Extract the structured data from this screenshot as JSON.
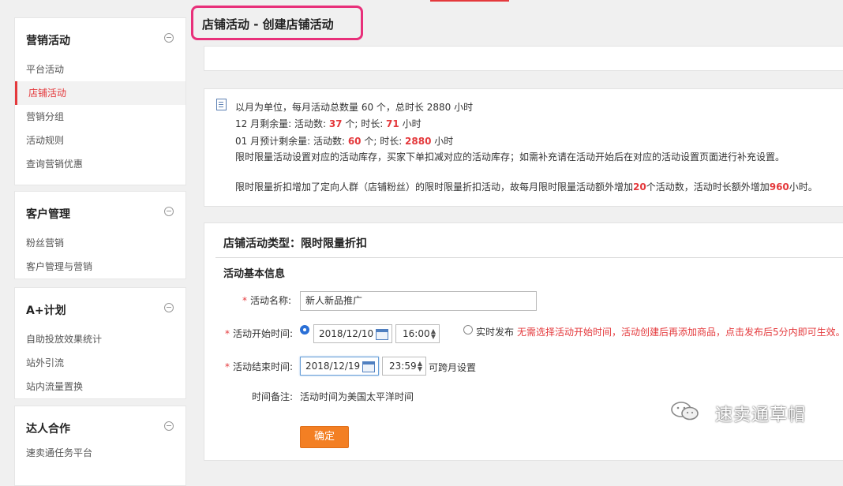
{
  "page": {
    "title": "店铺活动 - 创建店铺活动"
  },
  "sidebar": {
    "groups": [
      {
        "title": "营销活动",
        "items": [
          "平台活动",
          "店铺活动",
          "营销分组",
          "活动规则",
          "查询营销优惠"
        ],
        "active_index": 1
      },
      {
        "title": "客户管理",
        "items": [
          "粉丝营销",
          "客户管理与营销"
        ]
      },
      {
        "title": "A+计划",
        "items": [
          "自助投放效果统计",
          "站外引流",
          "站内流量置换"
        ]
      },
      {
        "title": "达人合作",
        "items": [
          "速卖通任务平台"
        ]
      }
    ]
  },
  "notice": {
    "line1": "以月为单位，每月活动总数量 60 个，总时长 2880 小时",
    "line2": {
      "prefix": "12 月剩余量: 活动数: ",
      "count": "37",
      "mid": " 个; 时长: ",
      "hours": "71",
      "suffix": " 小时"
    },
    "line3": {
      "prefix": "01 月预计剩余量: 活动数: ",
      "count": "60",
      "mid": " 个; 时长: ",
      "hours": "2880",
      "suffix": " 小时"
    },
    "line4": "限时限量活动设置对应的活动库存，买家下单扣减对应的活动库存；如需补充请在活动开始后在对应的活动设置页面进行补充设置。",
    "line5": {
      "prefix": "限时限量折扣增加了定向人群（店铺粉丝）的限时限量折扣活动，故每月限时限量活动额外增加",
      "count": "20",
      "mid": "个活动数，活动时长额外增加",
      "hours": "960",
      "suffix": "小时。"
    }
  },
  "form": {
    "type_title": "店铺活动类型：限时限量折扣",
    "section_title": "活动基本信息",
    "name_label": "活动名称:",
    "name_value": "新人新品推广",
    "start_label": "活动开始时间:",
    "start_date": "2018/12/10",
    "start_time": "16:00",
    "realtime_label": "实时发布",
    "realtime_hint": "无需选择活动开始时间，活动创建后再添加商品，点击发布后5分内即可生效。",
    "end_label": "活动结束时间:",
    "end_date": "2018/12/19",
    "end_time": "23:59",
    "cross_month": "可跨月设置",
    "remark_label": "时间备注:",
    "remark_value": "活动时间为美国太平洋时间",
    "confirm": "确定"
  },
  "watermark": {
    "text": "速卖通草帽"
  },
  "colors": {
    "accent": "#e4393c",
    "button": "#f37f23",
    "highlight_border": "#e8307a"
  }
}
